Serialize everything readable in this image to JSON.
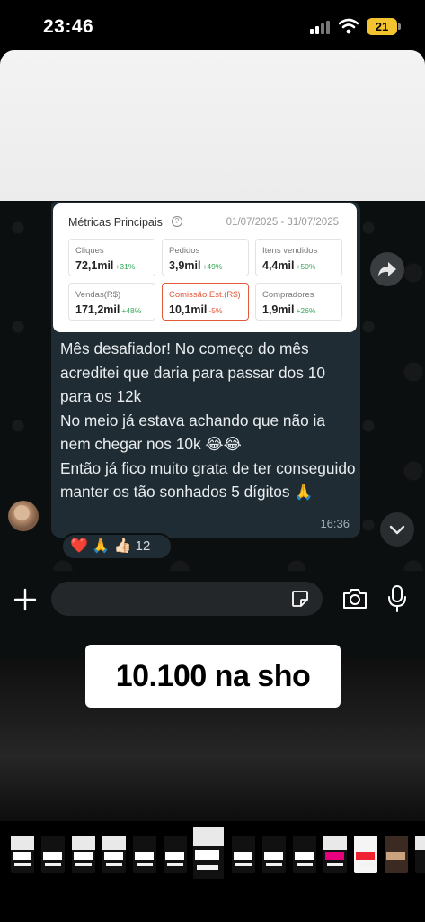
{
  "status_bar": {
    "time": "23:46",
    "battery": "21"
  },
  "metrics": {
    "title": "Métricas Principais",
    "info": "?",
    "date_range": "01/07/2025 - 31/07/2025",
    "items": [
      {
        "label": "Cliques",
        "value": "72,1mil",
        "change": "+31%"
      },
      {
        "label": "Pedidos",
        "value": "3,9mil",
        "change": "+49%"
      },
      {
        "label": "Itens vendidos",
        "value": "4,4mil",
        "change": "+50%"
      },
      {
        "label": "Vendas(R$)",
        "value": "171,2mil",
        "change": "+48%"
      },
      {
        "label": "Comissão Est.(R$)",
        "value": "10,1mil",
        "change": "-5%"
      },
      {
        "label": "Compradores",
        "value": "1,9mil",
        "change": "+26%"
      }
    ]
  },
  "message": {
    "text": "Mês desafiador! No começo do mês acreditei que daria para passar dos 10 para os 12k\nNo meio já estava achando que não ia nem chegar nos 10k 😂😂\nEntão já fico muito grata de ter conseguido manter os tão sonhados 5 dígitos 🙏",
    "time": "16:36"
  },
  "reactions": {
    "emojis": "❤️ 🙏 👍🏻",
    "count": "12"
  },
  "composer": {
    "placeholder": ""
  },
  "caption": "10.100 na sho",
  "icons": [
    "forward-icon",
    "chevron-down-icon",
    "plus-icon",
    "sticker-icon",
    "camera-icon",
    "mic-icon",
    "wifi-icon",
    "signal-icon",
    "battery-icon"
  ]
}
